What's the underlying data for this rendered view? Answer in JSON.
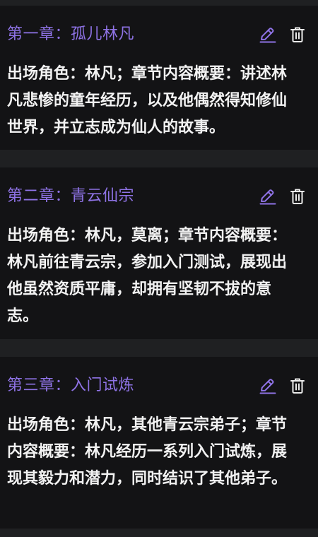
{
  "colors": {
    "background": "#1f2022",
    "card": "#131315",
    "accent": "#8f73e6",
    "text": "#f2f2f2"
  },
  "chapters": [
    {
      "title": "第一章：孤儿林凡",
      "summary": "出场角色：林凡；章节内容概要：讲述林凡悲惨的童年经历，以及他偶然得知修仙世界，并立志成为仙人的故事。",
      "edit_icon": "pencil-icon",
      "delete_icon": "trash-icon"
    },
    {
      "title": "第二章：青云仙宗",
      "summary": "出场角色：林凡，莫离；章节内容概要：林凡前往青云宗，参加入门测试，展现出他虽然资质平庸，却拥有坚韧不拔的意志。",
      "edit_icon": "pencil-icon",
      "delete_icon": "trash-icon"
    },
    {
      "title": "第三章：入门试炼",
      "summary": "出场角色：林凡，其他青云宗弟子；章节内容概要：林凡经历一系列入门试炼，展现其毅力和潜力，同时结识了其他弟子。",
      "edit_icon": "pencil-icon",
      "delete_icon": "trash-icon"
    }
  ]
}
